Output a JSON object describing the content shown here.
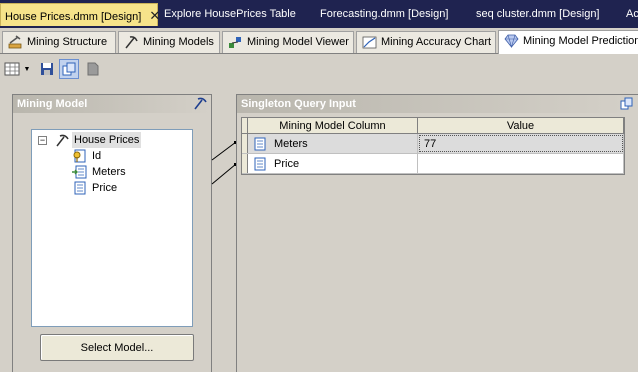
{
  "doc_tabs": [
    {
      "label": "House Prices.dmm [Design]",
      "active": true
    },
    {
      "label": "Explore HousePrices Table",
      "active": false
    },
    {
      "label": "Forecasting.dmm [Design]",
      "active": false
    },
    {
      "label": "seq cluster.dmm [Design]",
      "active": false
    },
    {
      "label": "Ac",
      "active": false
    }
  ],
  "designer_tabs": [
    {
      "label": "Mining Structure",
      "icon": "mining-structure-icon"
    },
    {
      "label": "Mining Models",
      "icon": "mining-models-icon"
    },
    {
      "label": "Mining Model Viewer",
      "icon": "model-viewer-icon"
    },
    {
      "label": "Mining Accuracy Chart",
      "icon": "accuracy-chart-icon"
    },
    {
      "label": "Mining Model Prediction",
      "icon": "prediction-diamond-icon",
      "active": true
    }
  ],
  "mining_model": {
    "title": "Mining Model",
    "tree": {
      "root": "House Prices",
      "columns": [
        {
          "name": "Id",
          "icon": "key-column-icon"
        },
        {
          "name": "Meters",
          "icon": "input-column-icon"
        },
        {
          "name": "Price",
          "icon": "predict-column-icon"
        }
      ]
    },
    "select_button": "Select Model..."
  },
  "singleton_query": {
    "title": "Singleton Query Input",
    "headers": [
      "Mining Model Column",
      "Value"
    ],
    "rows": [
      {
        "column": "Meters",
        "value": "77"
      },
      {
        "column": "Price",
        "value": ""
      }
    ]
  },
  "colors": {
    "doc_tab_strip": "#1f2350",
    "active_doc_tab": "#f6e38a",
    "background": "#d4d0c8"
  }
}
